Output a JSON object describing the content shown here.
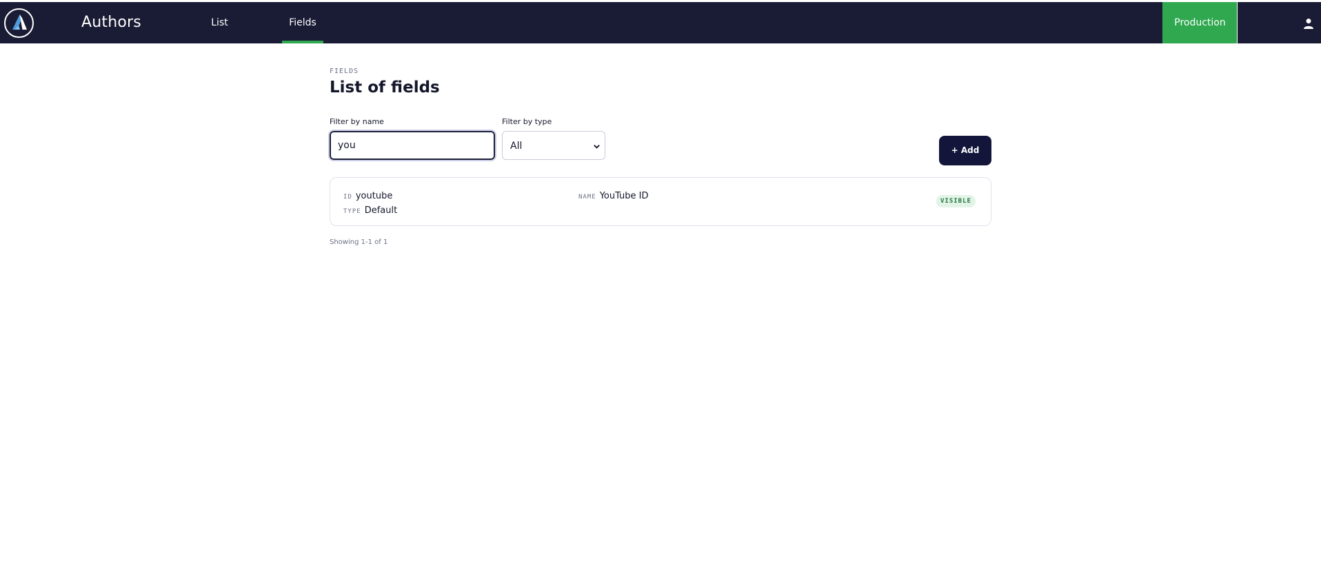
{
  "header": {
    "app_title": "Authors",
    "tabs": [
      {
        "label": "List",
        "active": false
      },
      {
        "label": "Fields",
        "active": true
      }
    ],
    "environment": "Production",
    "accent_color": "#2fa84f",
    "bar_color": "#1a1c35",
    "icons": {
      "logo": "app-logo",
      "user": "user-icon"
    }
  },
  "page": {
    "eyebrow": "FIELDS",
    "title": "List of fields"
  },
  "filters": {
    "name_label": "Filter by name",
    "name_value": "you",
    "type_label": "Filter by type",
    "type_value": "All"
  },
  "actions": {
    "add_label": "+ Add"
  },
  "fields": [
    {
      "id_key": "ID",
      "id": "youtube",
      "type_key": "TYPE",
      "type": "Default",
      "name_key": "NAME",
      "name": "YouTube ID",
      "status": "VISIBLE"
    }
  ],
  "pagination": {
    "text": "Showing 1-1 of 1"
  }
}
